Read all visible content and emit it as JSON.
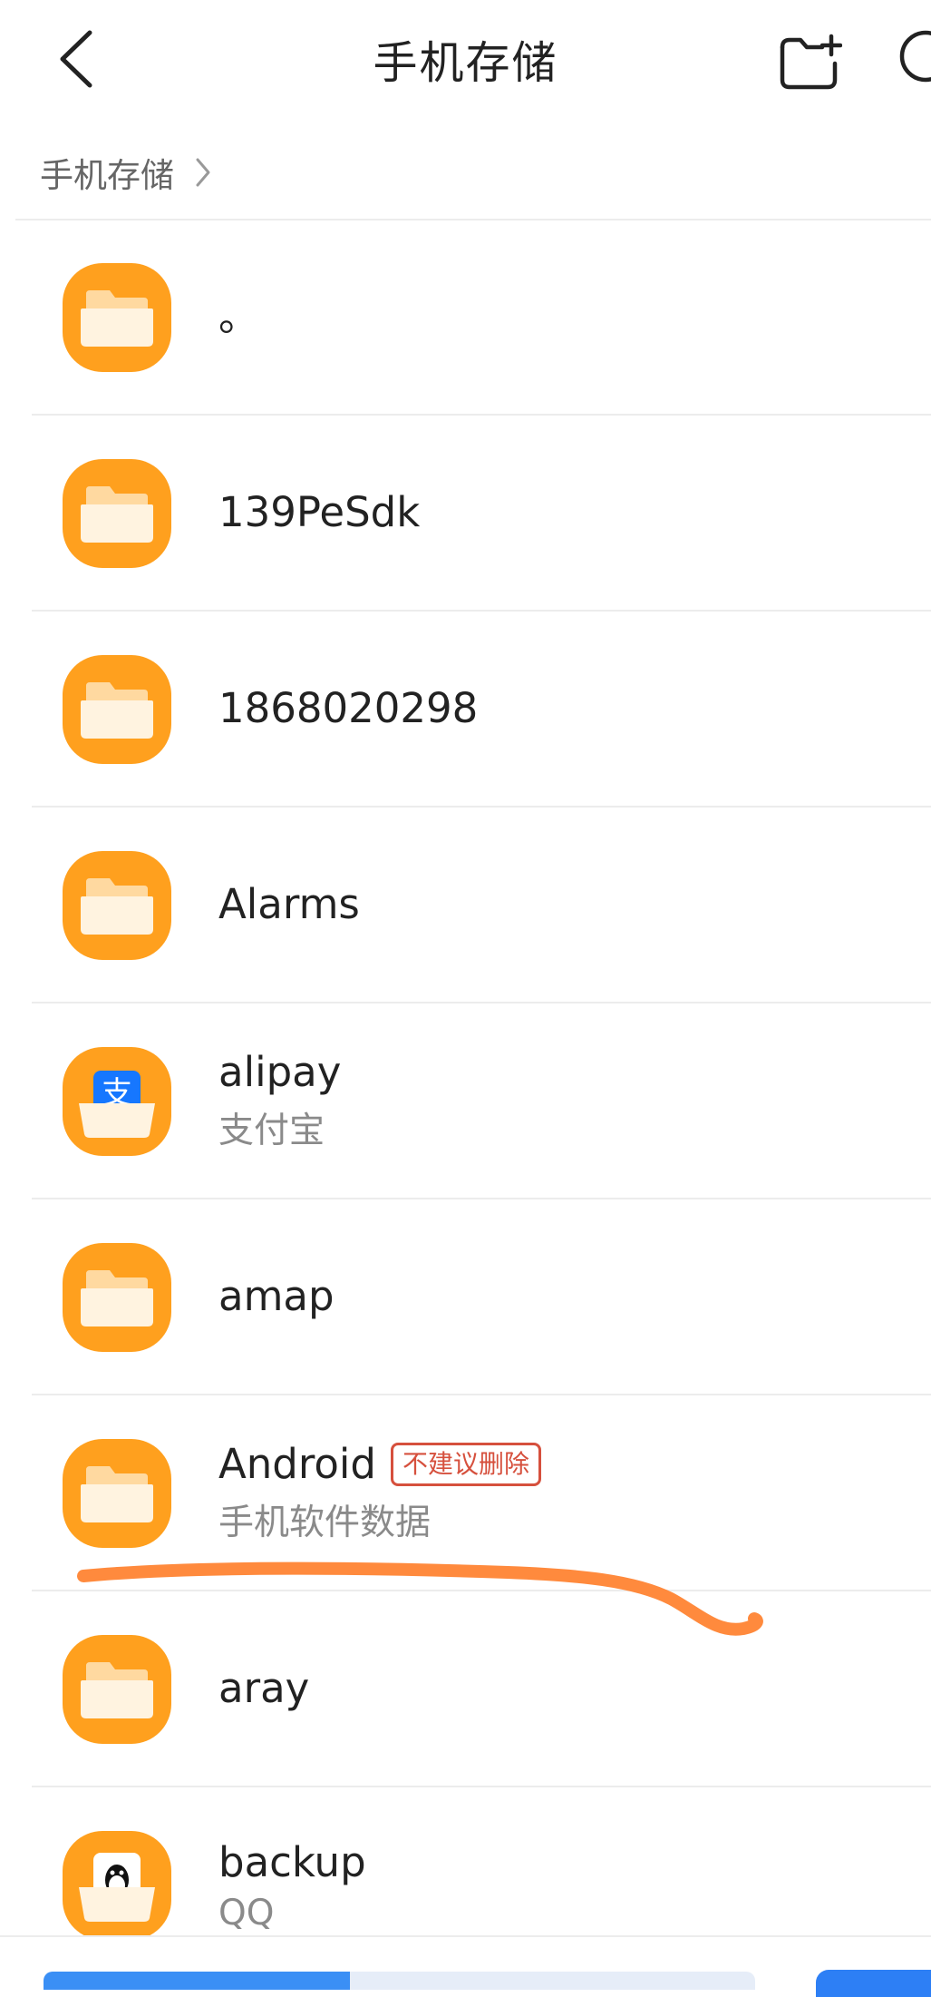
{
  "header": {
    "title": "手机存储"
  },
  "breadcrumb": {
    "root": "手机存储"
  },
  "folders": [
    {
      "name": "。",
      "subtitle": "",
      "badge": "",
      "icon": "folder-icon"
    },
    {
      "name": "139PeSdk",
      "subtitle": "",
      "badge": "",
      "icon": "folder-icon"
    },
    {
      "name": "1868020298",
      "subtitle": "",
      "badge": "",
      "icon": "folder-icon"
    },
    {
      "name": "Alarms",
      "subtitle": "",
      "badge": "",
      "icon": "folder-icon"
    },
    {
      "name": "alipay",
      "subtitle": "支付宝",
      "badge": "",
      "icon": "alipay-folder-icon"
    },
    {
      "name": "amap",
      "subtitle": "",
      "badge": "",
      "icon": "folder-icon"
    },
    {
      "name": "Android",
      "subtitle": "手机软件数据",
      "badge": "不建议删除",
      "icon": "folder-icon"
    },
    {
      "name": "aray",
      "subtitle": "",
      "badge": "",
      "icon": "folder-icon"
    },
    {
      "name": "backup",
      "subtitle": "QQ",
      "badge": "",
      "icon": "qq-folder-icon"
    }
  ],
  "storage": {
    "used_fraction": 0.43
  },
  "colors": {
    "folder": "#ffa01e",
    "accent": "#3a8ff5",
    "warning": "#d6503d",
    "annotation": "#ff8a3d"
  }
}
